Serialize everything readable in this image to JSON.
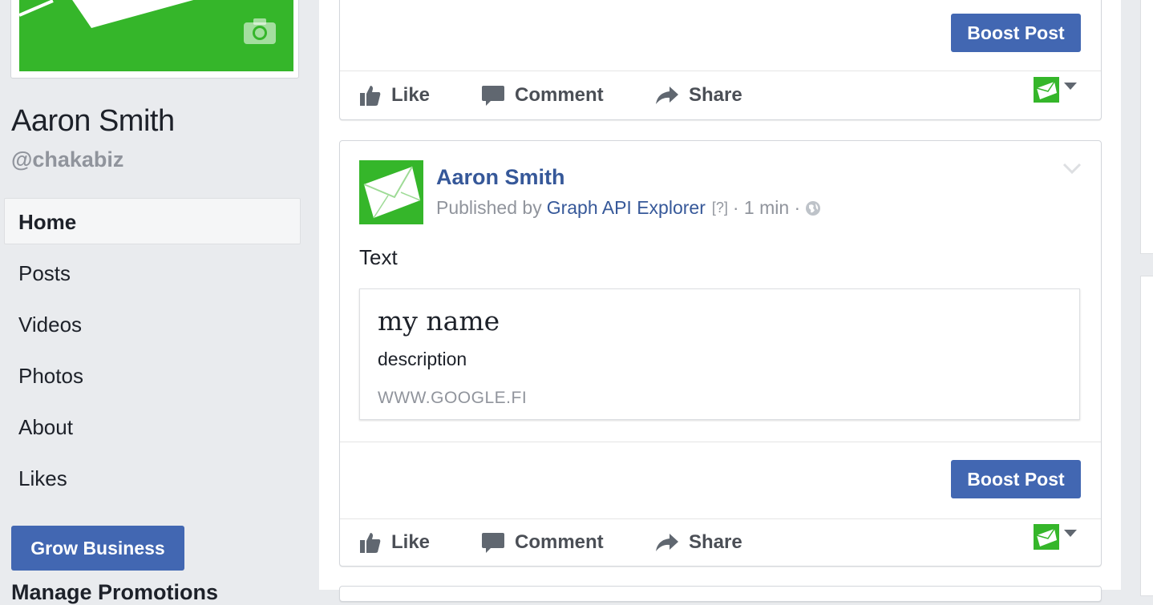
{
  "profile": {
    "name": "Aaron Smith",
    "handle": "@chakabiz"
  },
  "nav": {
    "items": [
      {
        "label": "Home",
        "active": true
      },
      {
        "label": "Posts"
      },
      {
        "label": "Videos"
      },
      {
        "label": "Photos"
      },
      {
        "label": "About"
      },
      {
        "label": "Likes"
      }
    ],
    "grow_button": "Grow Business",
    "cutoff_text": "Manage Promotions"
  },
  "actions": {
    "like": "Like",
    "comment": "Comment",
    "share": "Share",
    "boost": "Boost Post"
  },
  "post": {
    "author": "Aaron Smith",
    "published_by_prefix": "Published by",
    "app_name": "Graph API Explorer",
    "help_marker": "[?]",
    "time": "· 1 min ·",
    "text": "Text",
    "link_card": {
      "title": "my name",
      "description": "description",
      "url": "WWW.GOOGLE.FI"
    }
  },
  "colors": {
    "brand_blue": "#4267b2",
    "link_blue": "#365899",
    "page_green": "#35b62a",
    "page_bg": "#e9ebee"
  },
  "icons": [
    "camera-icon",
    "like-icon",
    "comment-icon",
    "share-icon",
    "envelope-icon",
    "chevron-down-icon",
    "globe-icon"
  ]
}
